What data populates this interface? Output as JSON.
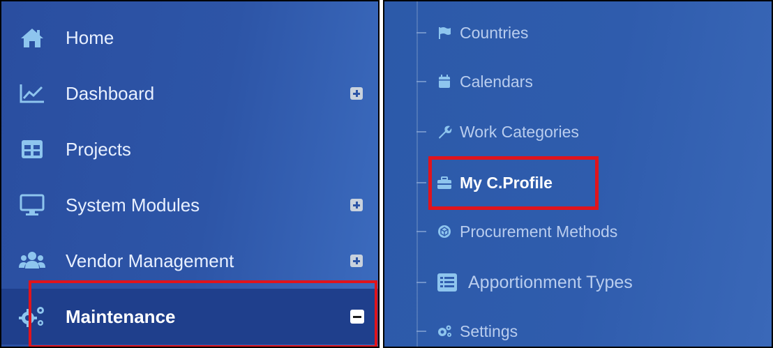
{
  "sidebar": {
    "items": [
      {
        "label": "Home",
        "icon": "home-icon",
        "expander": "none"
      },
      {
        "label": "Dashboard",
        "icon": "chart-line-icon",
        "expander": "plus"
      },
      {
        "label": "Projects",
        "icon": "table-grid-icon",
        "expander": "none"
      },
      {
        "label": "System Modules",
        "icon": "monitor-icon",
        "expander": "plus"
      },
      {
        "label": "Vendor Management",
        "icon": "users-icon",
        "expander": "plus"
      },
      {
        "label": "Maintenance",
        "icon": "cogs-icon",
        "expander": "minus",
        "active": true
      }
    ]
  },
  "submenu": {
    "items": [
      {
        "label": "Countries",
        "icon": "flag-icon"
      },
      {
        "label": "Calendars",
        "icon": "calendar-icon"
      },
      {
        "label": "Work Categories",
        "icon": "wrench-icon"
      },
      {
        "label": "My C.Profile",
        "icon": "briefcase-icon",
        "active": true
      },
      {
        "label": "Procurement Methods",
        "icon": "cube-icon"
      },
      {
        "label": "Apportionment Types",
        "icon": "list-icon"
      },
      {
        "label": "Settings",
        "icon": "cogs-icon"
      }
    ]
  },
  "colors": {
    "sidebar_bg": "#2d55a7",
    "active_bg": "#1f3f8c",
    "highlight": "#e0141c",
    "icon_light": "#8ec5ee"
  }
}
